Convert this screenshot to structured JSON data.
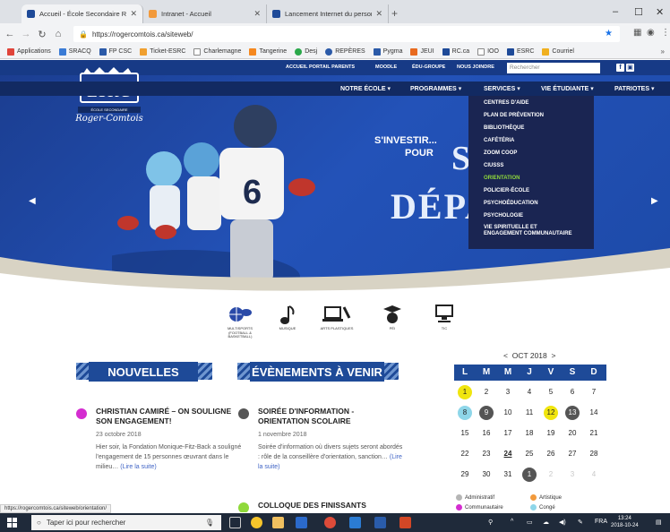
{
  "browser": {
    "tabs": [
      {
        "label": "Accueil - École Secondaire Roger",
        "color": "#1e4a98"
      },
      {
        "label": "Intranet - Accueil",
        "color": "#f29a3c"
      },
      {
        "label": "Lancement Internet du personnel",
        "color": "#1e4a98"
      }
    ],
    "new_tab": "+",
    "url": "https://rogercomtois.ca/siteweb/",
    "window": {
      "minimize": "–",
      "maximize": "☐",
      "close": "✕"
    },
    "bookmarks": [
      "Applications",
      "SRACQ",
      "FP CSC",
      "Ticket-ESRC",
      "Charlemagne",
      "Tangerine",
      "Desj",
      "REPÈRES",
      "Pygma",
      "JEUI",
      "RC.ca",
      "IOO",
      "ESRC",
      "Courriel"
    ],
    "bookmarks_more": "»",
    "status_url": "https://rogercomtois.ca/siteweb/orientation/"
  },
  "site": {
    "logo": {
      "name": "ESRC",
      "sub": "ÉCOLE SECONDAIRE",
      "script": "Roger-Comtois"
    },
    "topnav": [
      "ACCUEIL",
      "PORTAIL PARENTS",
      "MOODLE",
      "ÉDU-GROUPE",
      "NOUS JOINDRE"
    ],
    "search_placeholder": "Rechercher",
    "mainnav": [
      "NOTRE ÉCOLE",
      "PROGRAMMES",
      "SERVICES",
      "VIE ÉTUDIANTE",
      "PATRIOTES"
    ],
    "services_menu": [
      "CENTRES D'AIDE",
      "PLAN DE PRÉVENTION",
      "BIBLIOTHÈQUE",
      "CAFÉTÉRIA",
      "ZOOM COOP",
      "CIUSSS",
      "ORIENTATION",
      "POLICIER-ÉCOLE",
      "PSYCHOÉDUCATION",
      "PSYCHOLOGIE",
      "VIE SPIRITUELLE ET ENGAGEMENT COMMUNAUTAIRE"
    ],
    "hero": {
      "line1": "S'INVESTIR...",
      "line2": "POUR",
      "big1": "S",
      "big2": "DÉPA"
    },
    "categories": [
      {
        "label": "MULTISPORTS (FOOTBALL & BASKETBALL)"
      },
      {
        "label": "MUSIQUE"
      },
      {
        "label": "ARTS PLASTIQUES"
      },
      {
        "label": "PÉI"
      },
      {
        "label": "TIC"
      }
    ],
    "sections": {
      "news": "NOUVELLES",
      "events": "ÉVÈNEMENTS À VENIR"
    },
    "news": [
      {
        "title": "CHRISTIAN CAMIRÉ – ON SOULIGNE SON ENGAGEMENT!",
        "date": "23 octobre 2018",
        "body": "Hier soir, la Fondation Monique-Fitz-Back a souligné l'engagement de 15 personnes œuvrant dans le milieu…",
        "more": "(Lire la suite)"
      }
    ],
    "events": [
      {
        "title": "SOIRÉE D'INFORMATION - ORIENTATION SCOLAIRE",
        "date": "1 novembre 2018",
        "body": "Soirée d'information où divers sujets seront abordés : rôle de la conseillère d'orientation, sanction…",
        "more": "(Lire la suite)"
      },
      {
        "title": "COLLOQUE DES FINISSANTS"
      }
    ],
    "calendar": {
      "prev": "<",
      "month": "OCT 2018",
      "next": ">",
      "headers": [
        "L",
        "M",
        "M",
        "J",
        "V",
        "S",
        "D"
      ],
      "weeks": [
        [
          "1",
          "2",
          "3",
          "4",
          "5",
          "6",
          "7"
        ],
        [
          "8",
          "9",
          "10",
          "11",
          "12",
          "13",
          "14"
        ],
        [
          "15",
          "16",
          "17",
          "18",
          "19",
          "20",
          "21"
        ],
        [
          "22",
          "23",
          "24",
          "25",
          "26",
          "27",
          "28"
        ],
        [
          "29",
          "30",
          "31",
          "1",
          "2",
          "3",
          "4"
        ]
      ],
      "legend": [
        "Administratif",
        "Artistique",
        "Communautaire",
        "Congé"
      ]
    }
  },
  "taskbar": {
    "search": "Taper ici pour rechercher",
    "lang": "FRA",
    "time": "13:24",
    "date": "2018-10-24"
  }
}
